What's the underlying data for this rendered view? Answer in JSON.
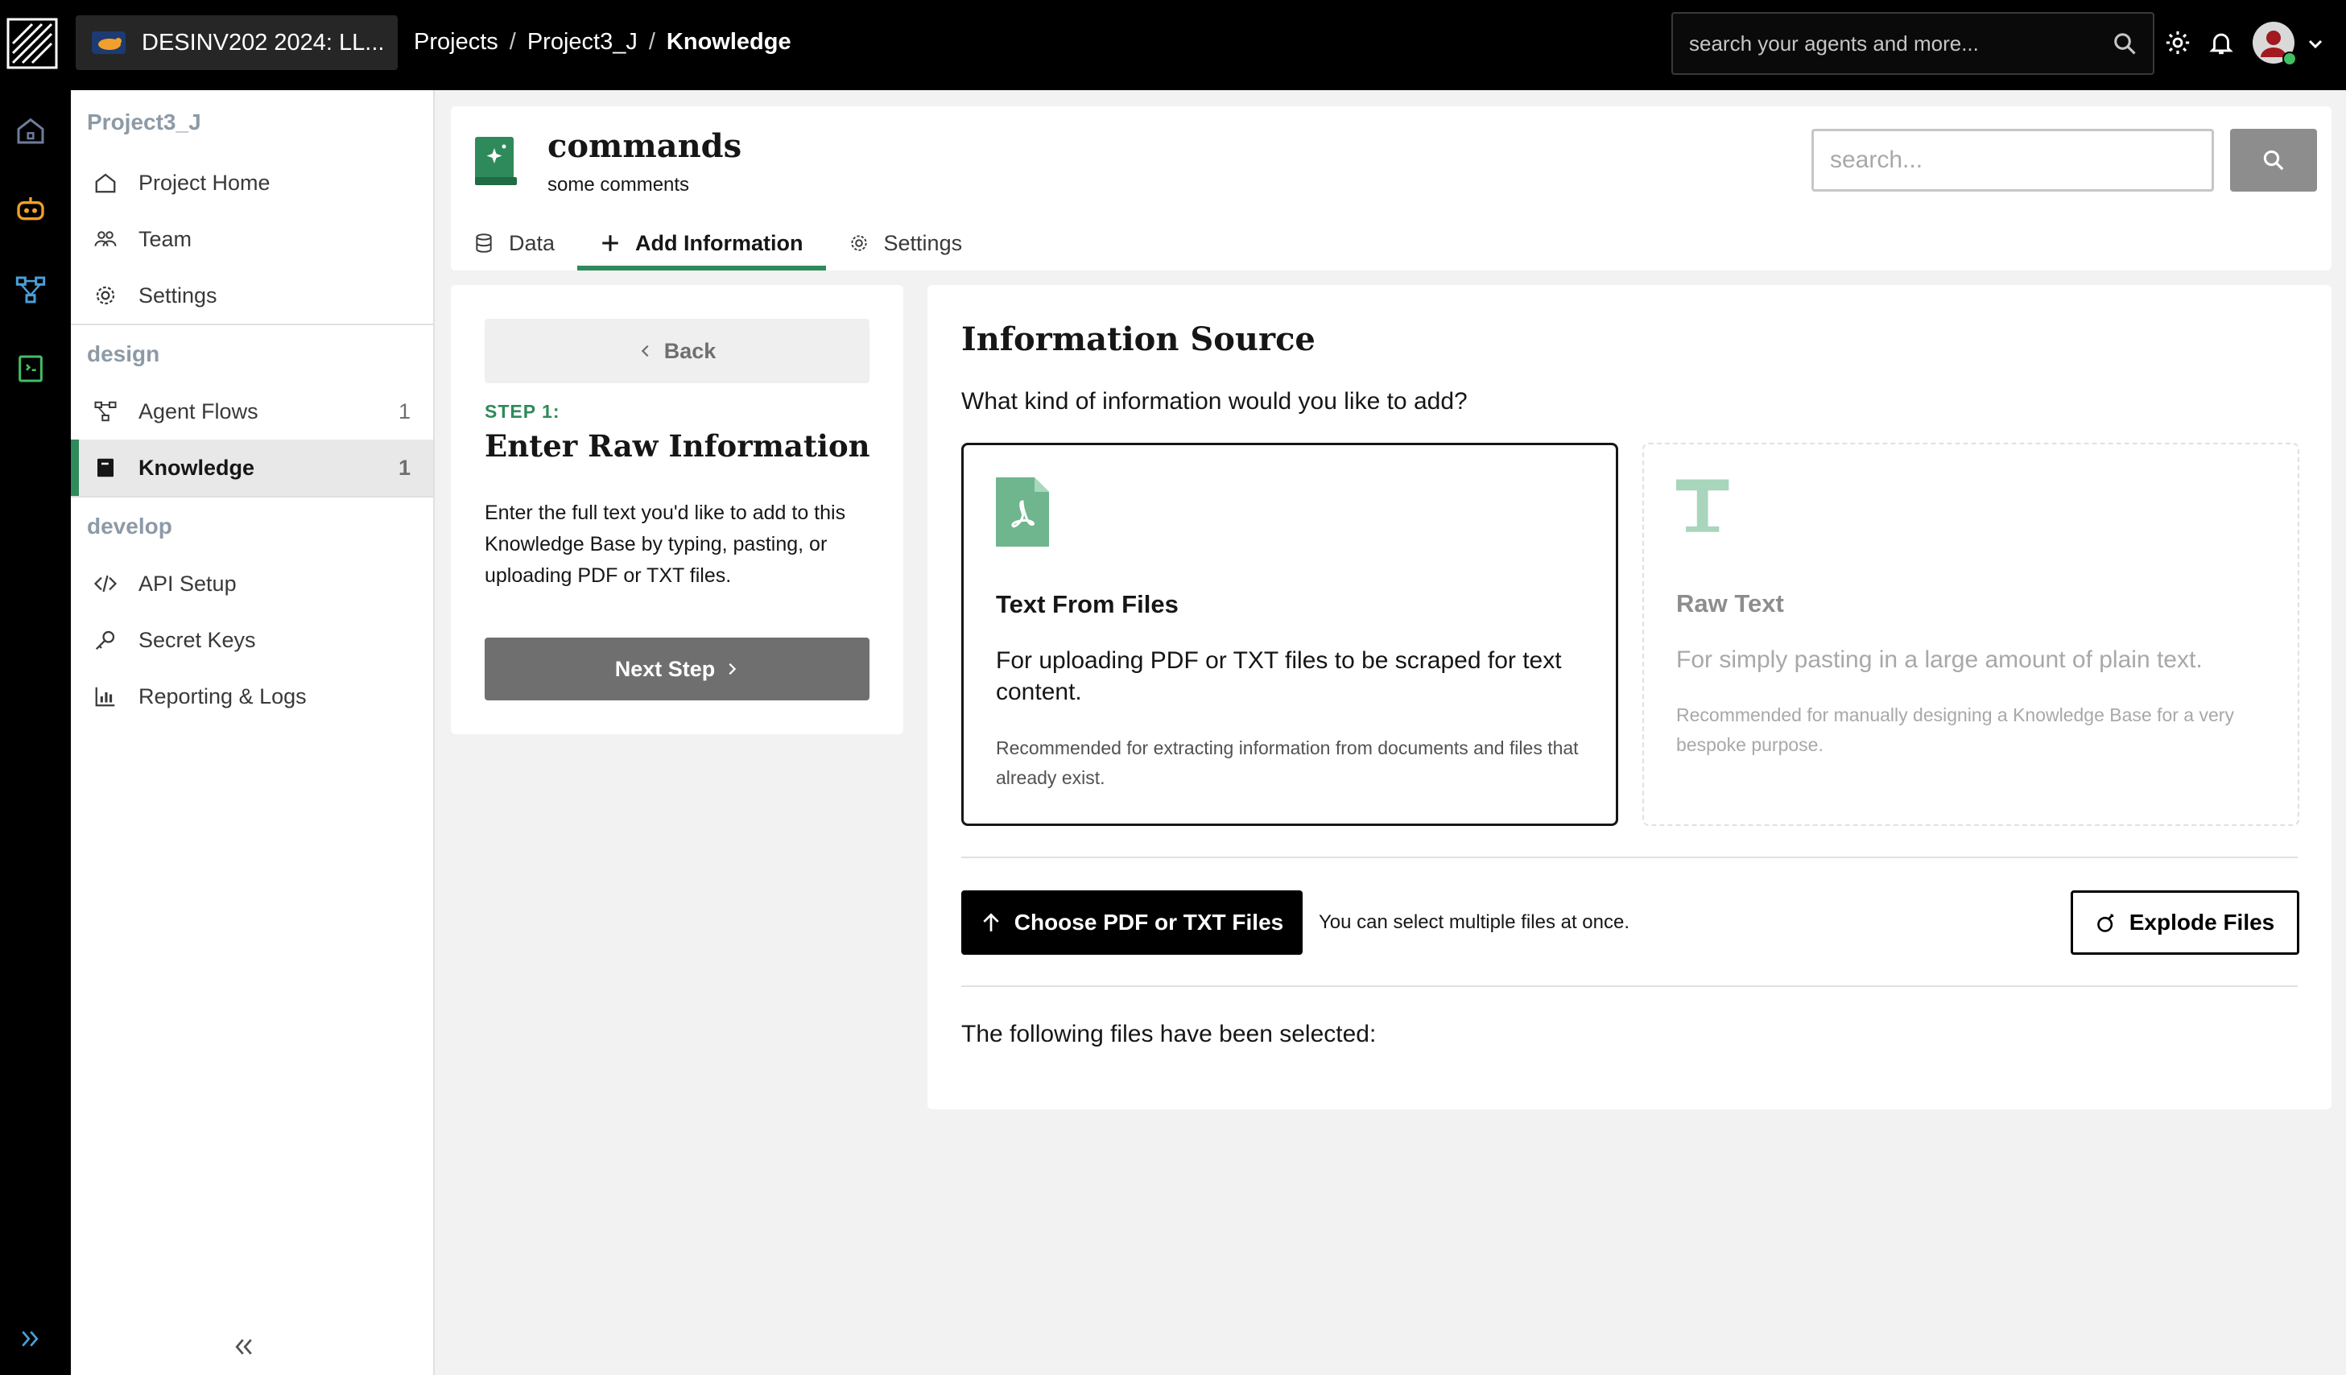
{
  "topbar": {
    "org_name": "DESINV202 2024: LL...",
    "breadcrumb": [
      "Projects",
      "Project3_J",
      "Knowledge"
    ],
    "search_placeholder": "search your agents and more..."
  },
  "sidebar": {
    "project_name": "Project3_J",
    "project_items": [
      {
        "label": "Project Home",
        "icon": "home-icon"
      },
      {
        "label": "Team",
        "icon": "team-icon"
      },
      {
        "label": "Settings",
        "icon": "gear-icon"
      }
    ],
    "design_label": "design",
    "design_items": [
      {
        "label": "Agent Flows",
        "count": "1",
        "icon": "flow-icon"
      },
      {
        "label": "Knowledge",
        "count": "1",
        "icon": "book-icon",
        "active": true
      }
    ],
    "develop_label": "develop",
    "develop_items": [
      {
        "label": "API Setup",
        "icon": "code-icon"
      },
      {
        "label": "Secret Keys",
        "icon": "key-icon"
      },
      {
        "label": "Reporting & Logs",
        "icon": "chart-icon"
      }
    ]
  },
  "header": {
    "title": "commands",
    "subtitle": "some comments",
    "search_placeholder": "search...",
    "tabs": [
      {
        "label": "Data",
        "icon": "database-icon"
      },
      {
        "label": "Add Information",
        "icon": "plus-icon",
        "active": true
      },
      {
        "label": "Settings",
        "icon": "gear-icon"
      }
    ]
  },
  "step": {
    "back_label": "Back",
    "step_label": "STEP 1:",
    "title": "Enter Raw Information",
    "description": "Enter the full text you'd like to add to this Knowledge Base by typing, pasting, or uploading PDF or TXT files.",
    "next_label": "Next Step"
  },
  "main": {
    "title": "Information Source",
    "question": "What kind of information would you like to add?",
    "options": [
      {
        "title": "Text From Files",
        "description": "For uploading PDF or TXT files to be scraped for text content.",
        "note": "Recommended for extracting information from documents and files that already exist.",
        "icon": "pdf-file-icon",
        "selected": true
      },
      {
        "title": "Raw Text",
        "description": "For simply pasting in a large amount of plain text.",
        "note": "Recommended for manually designing a Knowledge Base for a very bespoke purpose.",
        "icon": "text-icon",
        "selected": false
      }
    ],
    "choose_label": "Choose PDF or TXT Files",
    "multi_hint": "You can select multiple files at once.",
    "explode_label": "Explode Files",
    "selected_files_label": "The following files have been selected:"
  },
  "colors": {
    "accent_green": "#2e8a5a",
    "topbar_bg": "#000000",
    "rail_orange": "#f1a02b",
    "rail_blue": "#4a9fd8"
  }
}
